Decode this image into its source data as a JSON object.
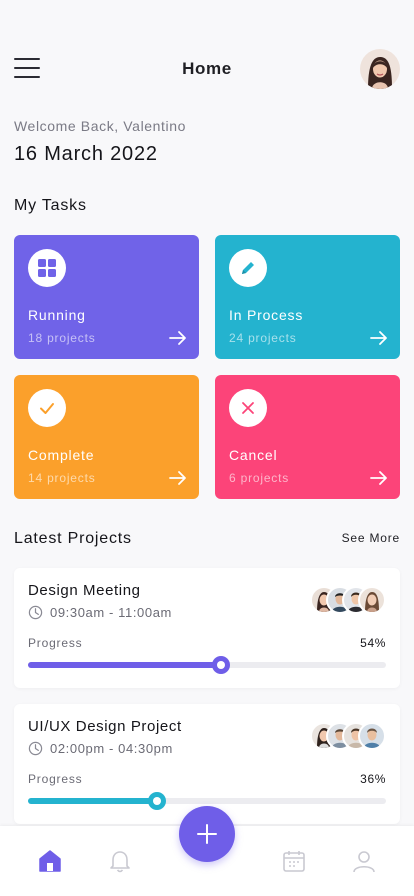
{
  "header": {
    "title": "Home",
    "menu_icon": "hamburger-menu-icon",
    "avatar_icon": "user-avatar"
  },
  "welcome": "Welcome Back, Valentino",
  "date": "16 March 2022",
  "tasks": {
    "title": "My Tasks",
    "items": [
      {
        "label": "Running",
        "count": "18 projects",
        "color": "#7063e8",
        "icon": "grid-icon"
      },
      {
        "label": "In Process",
        "count": "24 projects",
        "color": "#24b3cf",
        "icon": "pencil-icon"
      },
      {
        "label": "Complete",
        "count": "14 projects",
        "color": "#fba02b",
        "icon": "check-icon"
      },
      {
        "label": "Cancel",
        "count": "6 projects",
        "color": "#fc4479",
        "icon": "close-icon"
      }
    ]
  },
  "latest": {
    "title": "Latest Projects",
    "see_more": "See More",
    "projects": [
      {
        "name": "Design Meeting",
        "time": "09:30am - 11:00am",
        "progress_label": "Progress",
        "progress": "54%",
        "progress_value": 0.54,
        "color": "#6f5ee8"
      },
      {
        "name": "UI/UX Design Project",
        "time": "02:00pm - 04:30pm",
        "progress_label": "Progress",
        "progress": "36%",
        "progress_value": 0.36,
        "color": "#24b3cf"
      }
    ]
  },
  "nav": {
    "items": [
      "home-icon",
      "bell-icon",
      "add-icon",
      "calendar-icon",
      "profile-icon"
    ],
    "active_color": "#6f5ee8",
    "inactive_color": "#c9c9d1"
  }
}
